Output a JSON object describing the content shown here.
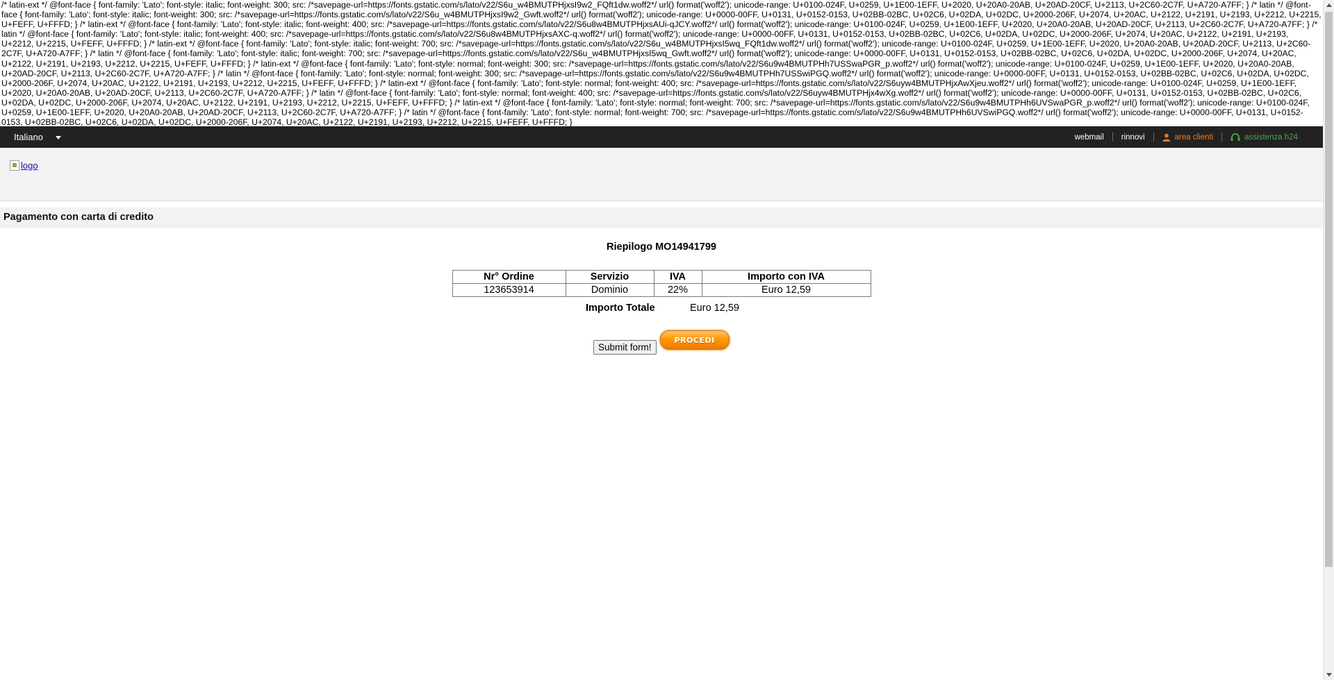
{
  "css_leak_text": "/* latin-ext */ @font-face { font-family: 'Lato'; font-style: italic; font-weight: 300; src: /*savepage-url=https://fonts.gstatic.com/s/lato/v22/S6u_w4BMUTPHjxsI9w2_FQft1dw.woff2*/ url() format('woff2'); unicode-range: U+0100-024F, U+0259, U+1E00-1EFF, U+2020, U+20A0-20AB, U+20AD-20CF, U+2113, U+2C60-2C7F, U+A720-A7FF; } /* latin */ @font-face { font-family: 'Lato'; font-style: italic; font-weight: 300; src: /*savepage-url=https://fonts.gstatic.com/s/lato/v22/S6u_w4BMUTPHjxsI9w2_Gwft.woff2*/ url() format('woff2'); unicode-range: U+0000-00FF, U+0131, U+0152-0153, U+02BB-02BC, U+02C6, U+02DA, U+02DC, U+2000-206F, U+2074, U+20AC, U+2122, U+2191, U+2193, U+2212, U+2215, U+FEFF, U+FFFD; } /* latin-ext */ @font-face { font-family: 'Lato'; font-style: italic; font-weight: 400; src: /*savepage-url=https://fonts.gstatic.com/s/lato/v22/S6u8w4BMUTPHjxsAUi-qJCY.woff2*/ url() format('woff2'); unicode-range: U+0100-024F, U+0259, U+1E00-1EFF, U+2020, U+20A0-20AB, U+20AD-20CF, U+2113, U+2C60-2C7F, U+A720-A7FF; } /* latin */ @font-face { font-family: 'Lato'; font-style: italic; font-weight: 400; src: /*savepage-url=https://fonts.gstatic.com/s/lato/v22/S6u8w4BMUTPHjxsAXC-q.woff2*/ url() format('woff2'); unicode-range: U+0000-00FF, U+0131, U+0152-0153, U+02BB-02BC, U+02C6, U+02DA, U+02DC, U+2000-206F, U+2074, U+20AC, U+2122, U+2191, U+2193, U+2212, U+2215, U+FEFF, U+FFFD; } /* latin-ext */ @font-face { font-family: 'Lato'; font-style: italic; font-weight: 700; src: /*savepage-url=https://fonts.gstatic.com/s/lato/v22/S6u_w4BMUTPHjxsI5wq_FQft1dw.woff2*/ url() format('woff2'); unicode-range: U+0100-024F, U+0259, U+1E00-1EFF, U+2020, U+20A0-20AB, U+20AD-20CF, U+2113, U+2C60-2C7F, U+A720-A7FF; } /* latin */ @font-face { font-family: 'Lato'; font-style: italic; font-weight: 700; src: /*savepage-url=https://fonts.gstatic.com/s/lato/v22/S6u_w4BMUTPHjxsI5wq_Gwft.woff2*/ url() format('woff2'); unicode-range: U+0000-00FF, U+0131, U+0152-0153, U+02BB-02BC, U+02C6, U+02DA, U+02DC, U+2000-206F, U+2074, U+20AC, U+2122, U+2191, U+2193, U+2212, U+2215, U+FEFF, U+FFFD; } /* latin-ext */ @font-face { font-family: 'Lato'; font-style: normal; font-weight: 300; src: /*savepage-url=https://fonts.gstatic.com/s/lato/v22/S6u9w4BMUTPHh7USSwaPGR_p.woff2*/ url() format('woff2'); unicode-range: U+0100-024F, U+0259, U+1E00-1EFF, U+2020, U+20A0-20AB, U+20AD-20CF, U+2113, U+2C60-2C7F, U+A720-A7FF; } /* latin */ @font-face { font-family: 'Lato'; font-style: normal; font-weight: 300; src: /*savepage-url=https://fonts.gstatic.com/s/lato/v22/S6u9w4BMUTPHh7USSwiPGQ.woff2*/ url() format('woff2'); unicode-range: U+0000-00FF, U+0131, U+0152-0153, U+02BB-02BC, U+02C6, U+02DA, U+02DC, U+2000-206F, U+2074, U+20AC, U+2122, U+2191, U+2193, U+2212, U+2215, U+FEFF, U+FFFD; } /* latin-ext */ @font-face { font-family: 'Lato'; font-style: normal; font-weight: 400; src: /*savepage-url=https://fonts.gstatic.com/s/lato/v22/S6uyw4BMUTPHjxAwXjeu.woff2*/ url() format('woff2'); unicode-range: U+0100-024F, U+0259, U+1E00-1EFF, U+2020, U+20A0-20AB, U+20AD-20CF, U+2113, U+2C60-2C7F, U+A720-A7FF; } /* latin */ @font-face { font-family: 'Lato'; font-style: normal; font-weight: 400; src: /*savepage-url=https://fonts.gstatic.com/s/lato/v22/S6uyw4BMUTPHjx4wXg.woff2*/ url() format('woff2'); unicode-range: U+0000-00FF, U+0131, U+0152-0153, U+02BB-02BC, U+02C6, U+02DA, U+02DC, U+2000-206F, U+2074, U+20AC, U+2122, U+2191, U+2193, U+2212, U+2215, U+FEFF, U+FFFD; } /* latin-ext */ @font-face { font-family: 'Lato'; font-style: normal; font-weight: 700; src: /*savepage-url=https://fonts.gstatic.com/s/lato/v22/S6u9w4BMUTPHh6UVSwaPGR_p.woff2*/ url() format('woff2'); unicode-range: U+0100-024F, U+0259, U+1E00-1EFF, U+2020, U+20A0-20AB, U+20AD-20CF, U+2113, U+2C60-2C7F, U+A720-A7FF; } /* latin */ @font-face { font-family: 'Lato'; font-style: normal; font-weight: 700; src: /*savepage-url=https://fonts.gstatic.com/s/lato/v22/S6u9w4BMUTPHh6UVSwiPGQ.woff2*/ url() format('woff2'); unicode-range: U+0000-00FF, U+0131, U+0152-0153, U+02BB-02BC, U+02C6, U+02DA, U+02DC, U+2000-206F, U+2074, U+20AC, U+2122, U+2191, U+2193, U+2212, U+2215, U+FEFF, U+FFFD; }",
  "topbar": {
    "language": "Italiano",
    "links": {
      "webmail": "webmail",
      "rinnovi": "rinnovi",
      "area_clienti": "area clienti",
      "assistenza": "assistenza h24"
    }
  },
  "header": {
    "logo_alt": "logo"
  },
  "section": {
    "title": "Pagamento con carta di credito"
  },
  "recap": {
    "title": "Riepilogo MO14941799",
    "table": {
      "headers": [
        "Nr° Ordine",
        "Servizio",
        "IVA",
        "Importo con IVA"
      ],
      "rows": [
        [
          "123653914",
          "Dominio",
          "22%",
          "Euro 12,59"
        ]
      ]
    },
    "total_label": "Importo Totale",
    "total_value": "Euro 12,59"
  },
  "actions": {
    "submit_label": "Submit form!",
    "procedi_label": "PROCEDI"
  },
  "colors": {
    "topbar_bg": "#222222",
    "orange_accent": "#f47a20",
    "green_accent": "#4ca64c",
    "header_bg": "#f2f2f2"
  }
}
